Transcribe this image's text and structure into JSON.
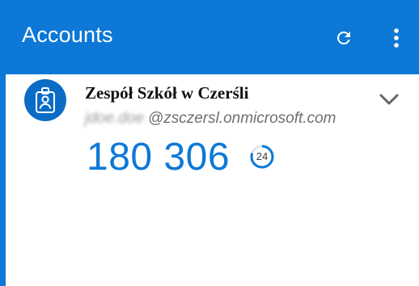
{
  "appbar": {
    "title": "Accounts",
    "refresh_icon": "refresh-icon",
    "menu_icon": "more-vertical-icon",
    "background": "#0d78d6"
  },
  "account": {
    "name": "Zespół Szkół w Czerśli",
    "email_user": "jdoe.doe",
    "email_domain": "@zsczersl.onmicrosoft.com",
    "avatar_icon": "work-badge-icon",
    "expand_icon": "chevron-down-icon",
    "code": "180 306",
    "timer_seconds": "24",
    "timer_remaining_fraction": 0.8,
    "code_color": "#0d78d6"
  }
}
